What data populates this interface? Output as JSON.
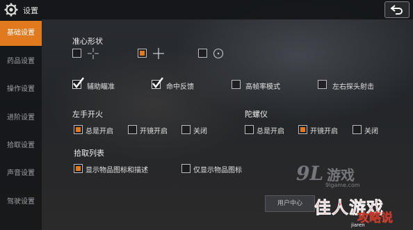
{
  "header": {
    "title": "设置",
    "back_icon": "back-icon",
    "settings_icon": "gear-icon"
  },
  "sidebar": {
    "items": [
      {
        "label": "基础设置",
        "active": true
      },
      {
        "label": "药品设置",
        "active": false
      },
      {
        "label": "操作设置",
        "active": false
      },
      {
        "label": "进阶设置",
        "active": false
      },
      {
        "label": "拾取设置",
        "active": false
      },
      {
        "label": "声音设置",
        "active": false
      },
      {
        "label": "驾驶设置",
        "active": false
      }
    ]
  },
  "crosshair": {
    "title": "准心形状",
    "options": [
      {
        "icon": "crosshair-thin-icon",
        "checked": false
      },
      {
        "icon": "crosshair-cross-icon",
        "checked": true
      },
      {
        "icon": "crosshair-circle-icon",
        "checked": false
      }
    ]
  },
  "toggles": [
    {
      "label": "辅助瞄准",
      "checked": true
    },
    {
      "label": "命中反馈",
      "checked": true
    },
    {
      "label": "高帧率模式",
      "checked": false
    },
    {
      "label": "左右探头射击",
      "checked": false
    }
  ],
  "left_fire": {
    "title": "左手开火",
    "options": [
      {
        "label": "总是开启",
        "checked": true
      },
      {
        "label": "开镜开启",
        "checked": false
      },
      {
        "label": "关闭",
        "checked": false
      }
    ]
  },
  "gyro": {
    "title": "陀螺仪",
    "options": [
      {
        "label": "总是开启",
        "checked": false
      },
      {
        "label": "开镜开启",
        "checked": true
      },
      {
        "label": "关闭",
        "checked": false
      }
    ]
  },
  "pickup_list": {
    "title": "拾取列表",
    "options": [
      {
        "label": "显示物品图标和描述",
        "checked": true
      },
      {
        "label": "仅显示物品图标",
        "checked": false
      }
    ]
  },
  "footer": {
    "user_center": "用户中心"
  },
  "watermark": {
    "logo": "9L",
    "text": "游戏",
    "url": "9lgame.com",
    "brand": "佳人游戏",
    "stamp": "攻略说",
    "brand_url": "jiaren"
  },
  "colors": {
    "accent": "#e07a1f",
    "topbar": "#14161a",
    "text": "#e8e8e8"
  }
}
